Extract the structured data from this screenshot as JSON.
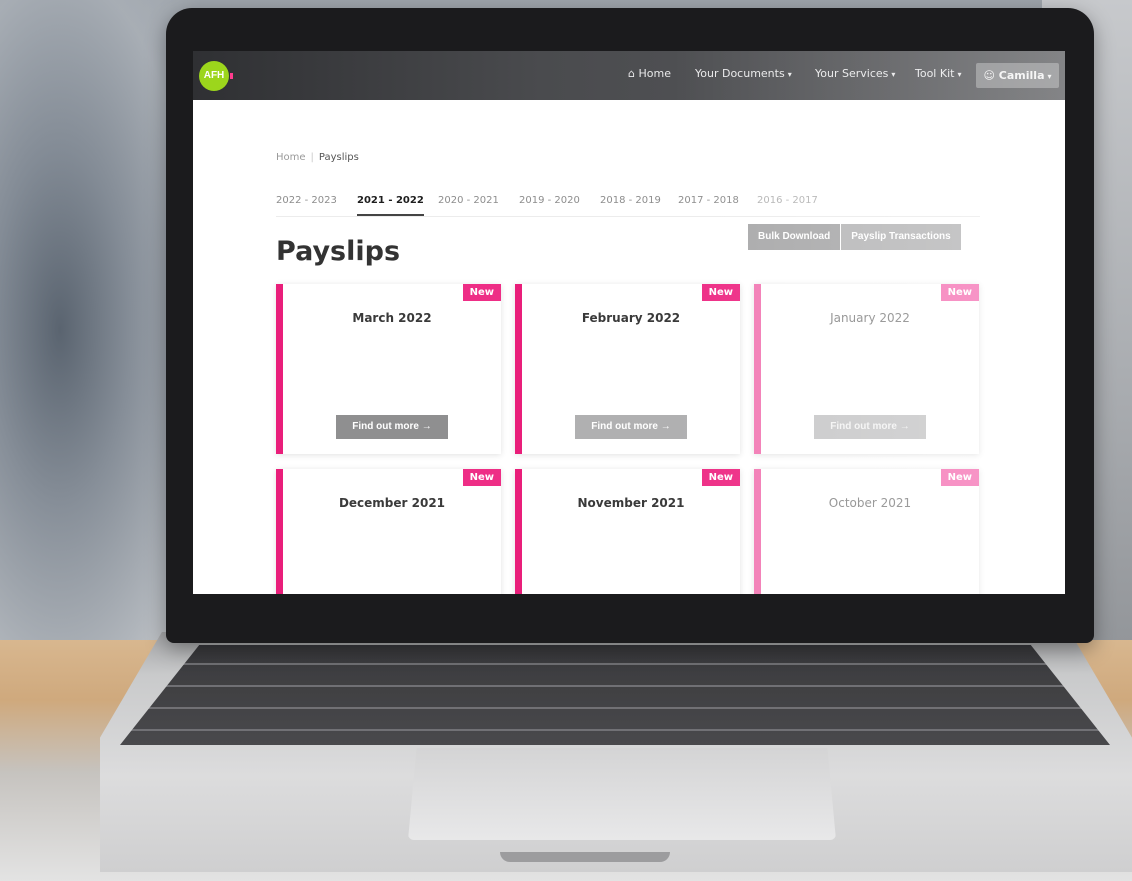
{
  "navbar": {
    "logo_text": "AFH",
    "home": "Home",
    "home_icon": "home-icon",
    "documents": "Your Documents",
    "services": "Your Services",
    "toolkit": "Tool Kit",
    "user": "Camilla",
    "user_icon": "user-icon",
    "caret": "▾"
  },
  "breadcrumb": {
    "home": "Home",
    "separator": "|",
    "current": "Payslips"
  },
  "year_tabs": [
    "2022 - 2023",
    "2021 - 2022",
    "2020 - 2021",
    "2019 - 2020",
    "2018 - 2019",
    "2017 - 2018",
    "2016 - 2017"
  ],
  "active_year": "2021 - 2022",
  "page_title": "Payslips",
  "actions": {
    "bulk_download": "Bulk Download",
    "transactions": "Payslip Transactions"
  },
  "cards": [
    {
      "title": "March 2022",
      "badge": "New",
      "button": "Find out more →"
    },
    {
      "title": "February 2022",
      "badge": "New",
      "button": "Find out more →"
    },
    {
      "title": "January 2022",
      "badge": "New",
      "button": "Find out more →"
    },
    {
      "title": "December 2021",
      "badge": "New"
    },
    {
      "title": "November 2021",
      "badge": "New"
    },
    {
      "title": "October 2021",
      "badge": "New"
    }
  ],
  "colors": {
    "accent": "#e91e7a",
    "badge": "#ee2e86",
    "logo": "#9cd61c",
    "navbar": "#4a4b4e"
  }
}
